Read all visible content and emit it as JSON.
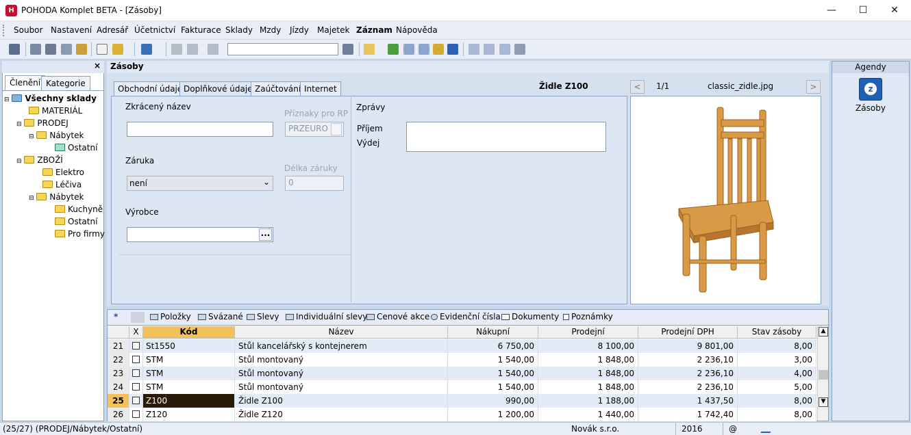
{
  "window": {
    "title": "POHODA Komplet BETA - [Zásoby]",
    "logo": "H",
    "minimize_icon": "minimize-icon",
    "maximize_icon": "maximize-icon",
    "close_icon": "close-icon"
  },
  "menu": [
    "Soubor",
    "Nastavení",
    "Adresář",
    "Účetnictví",
    "Fakturace",
    "Sklady",
    "Mzdy",
    "Jízdy",
    "Majetek",
    "Záznam",
    "Nápověda"
  ],
  "left": {
    "tabs": [
      "Členění",
      "Kategorie"
    ],
    "close": "×",
    "tree": [
      "Všechny sklady",
      "MATERIÁL",
      "PRODEJ",
      "Nábytek",
      "Ostatní",
      "ZBOŽÍ",
      "Elektro",
      "Léčiva",
      "Nábytek",
      "Kuchyně",
      "Ostatní",
      "Pro firmy"
    ]
  },
  "main": {
    "title": "Zásoby",
    "tabs": [
      "Obchodní údaje",
      "Doplňkové údaje",
      "Zaúčtování",
      "Internet"
    ],
    "record": "Židle Z100"
  },
  "form": {
    "short_name_label": "Zkrácený název",
    "short_name_value": "",
    "rp_label": "Příznaky pro RP",
    "rp_value": "PRZEURO",
    "warranty_label": "Záruka",
    "warranty_value": "není",
    "warranty_len_label": "Délka záruky",
    "warranty_len_value": "0",
    "producer_label": "Výrobce",
    "producer_value": "",
    "producer_btn": "...",
    "messages_label": "Zprávy",
    "income_label": "Příjem",
    "issue_label": "Výdej"
  },
  "image": {
    "prev": "<",
    "next": ">",
    "counter": "1/1",
    "filename": "classic_zidle.jpg"
  },
  "grid": {
    "tabs": [
      "*",
      "",
      "Položky",
      "Svázané",
      "Slevy",
      "Individuální slevy",
      "Cenové akce",
      "Evidenční čísla",
      "Dokumenty",
      "Poznámky"
    ],
    "columns": [
      "",
      "X",
      "Kód",
      "Název",
      "Nákupní",
      "Prodejní",
      "Prodejní DPH",
      "Stav zásoby"
    ],
    "rows": [
      {
        "n": "21",
        "code": "St1550",
        "name": "Stůl kancelářský s kontejnerem",
        "buy": "6 750,00",
        "sell": "8 100,00",
        "sell_vat": "9 801,00",
        "stock": "8,00"
      },
      {
        "n": "22",
        "code": "STM",
        "name": "Stůl montovaný",
        "buy": "1 540,00",
        "sell": "1 848,00",
        "sell_vat": "2 236,10",
        "stock": "3,00"
      },
      {
        "n": "23",
        "code": "STM",
        "name": "Stůl montovaný",
        "buy": "1 540,00",
        "sell": "1 848,00",
        "sell_vat": "2 236,10",
        "stock": "4,00"
      },
      {
        "n": "24",
        "code": "STM",
        "name": "Stůl montovaný",
        "buy": "1 540,00",
        "sell": "1 848,00",
        "sell_vat": "2 236,10",
        "stock": "5,00"
      },
      {
        "n": "25",
        "code": "Z100",
        "name": "Židle Z100",
        "buy": "990,00",
        "sell": "1 188,00",
        "sell_vat": "1 437,50",
        "stock": "8,00"
      },
      {
        "n": "26",
        "code": "Z120",
        "name": "Židle Z120",
        "buy": "1 200,00",
        "sell": "1 440,00",
        "sell_vat": "1 742,40",
        "stock": "8,00"
      }
    ]
  },
  "right": {
    "title": "Agendy",
    "item": "Zásoby"
  },
  "status": {
    "position": "(25/27) (PRODEJ/Nábytek/Ostatní)",
    "company": "Novák s.r.o.",
    "year": "2016",
    "at": "@"
  },
  "colors": {
    "accent": "#1a57a8",
    "selected_code_bg": "#2a1a08",
    "row_number_selected": "#f4c05a"
  }
}
